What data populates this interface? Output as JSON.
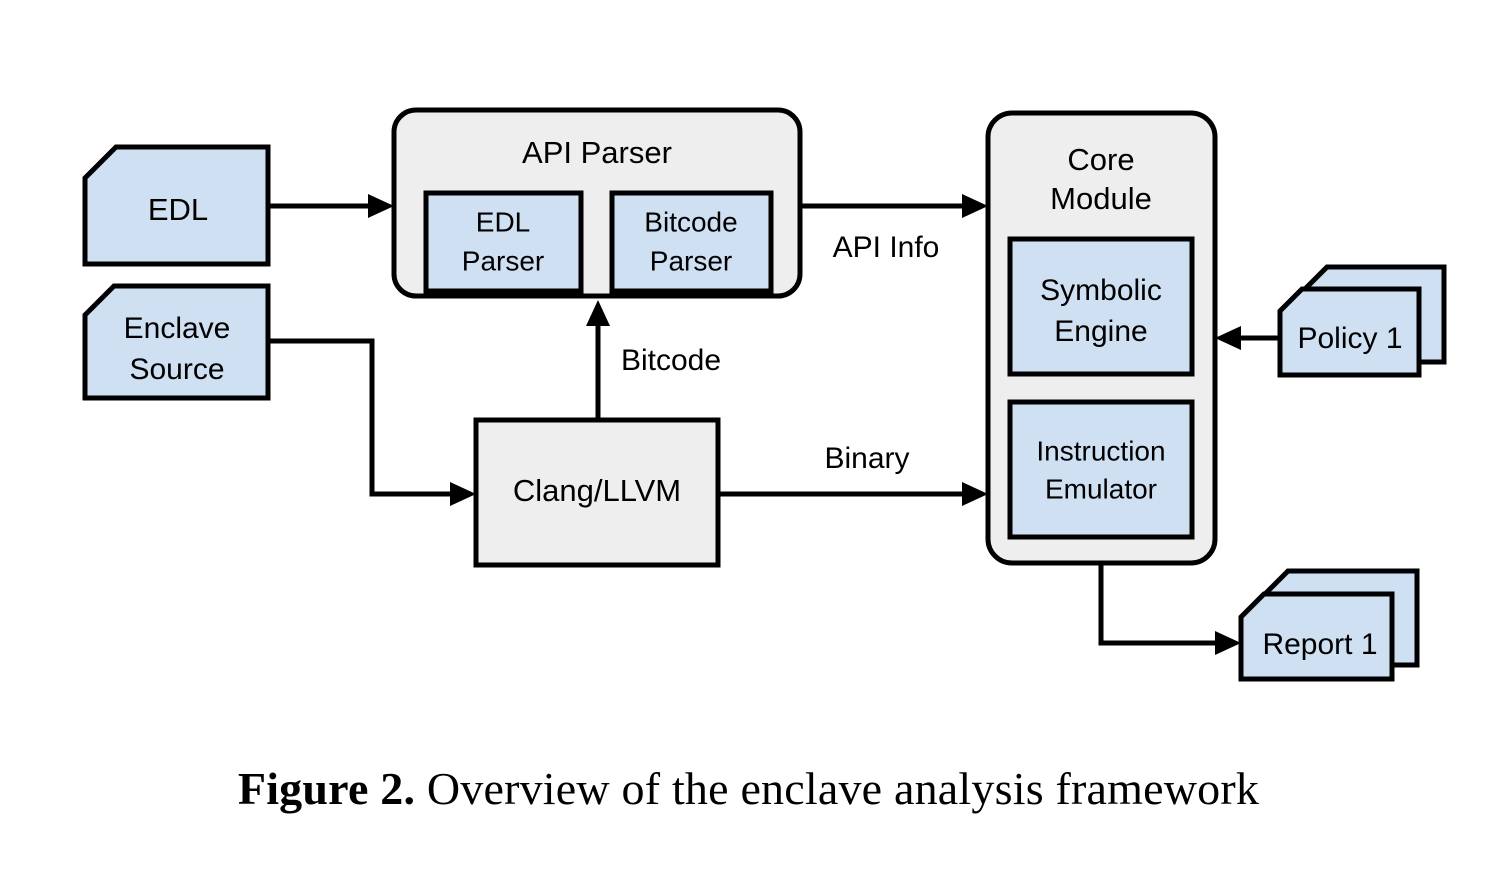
{
  "figure": {
    "caption_prefix": "Figure 2.",
    "caption_text": " Overview of the enclave analysis framework"
  },
  "colors": {
    "node_blue": "#cfe0f3",
    "container_gray": "#eeeeee",
    "stroke": "#000000",
    "background": "#ffffff"
  },
  "nodes": {
    "edl": {
      "label": "EDL"
    },
    "enclave_source": {
      "label_line1": "Enclave",
      "label_line2": "Source"
    },
    "api_parser": {
      "title": "API Parser"
    },
    "edl_parser": {
      "label_line1": "EDL",
      "label_line2": "Parser"
    },
    "bitcode_parser": {
      "label_line1": "Bitcode",
      "label_line2": "Parser"
    },
    "clang_llvm": {
      "label": "Clang/LLVM"
    },
    "core_module": {
      "title_line1": "Core",
      "title_line2": "Module"
    },
    "symbolic_engine": {
      "label_line1": "Symbolic",
      "label_line2": "Engine"
    },
    "instruction_emulator": {
      "label_line1": "Instruction",
      "label_line2": "Emulator"
    },
    "policy": {
      "label": "Policy 1"
    },
    "report": {
      "label": "Report 1"
    }
  },
  "edges": {
    "edl_to_api_parser": {
      "label": ""
    },
    "api_parser_to_core": {
      "label": "API Info"
    },
    "clang_to_api_parser": {
      "label": "Bitcode"
    },
    "clang_to_core": {
      "label": "Binary"
    },
    "enclave_to_clang": {
      "label": ""
    },
    "policy_to_core": {
      "label": ""
    },
    "core_to_report": {
      "label": ""
    }
  }
}
